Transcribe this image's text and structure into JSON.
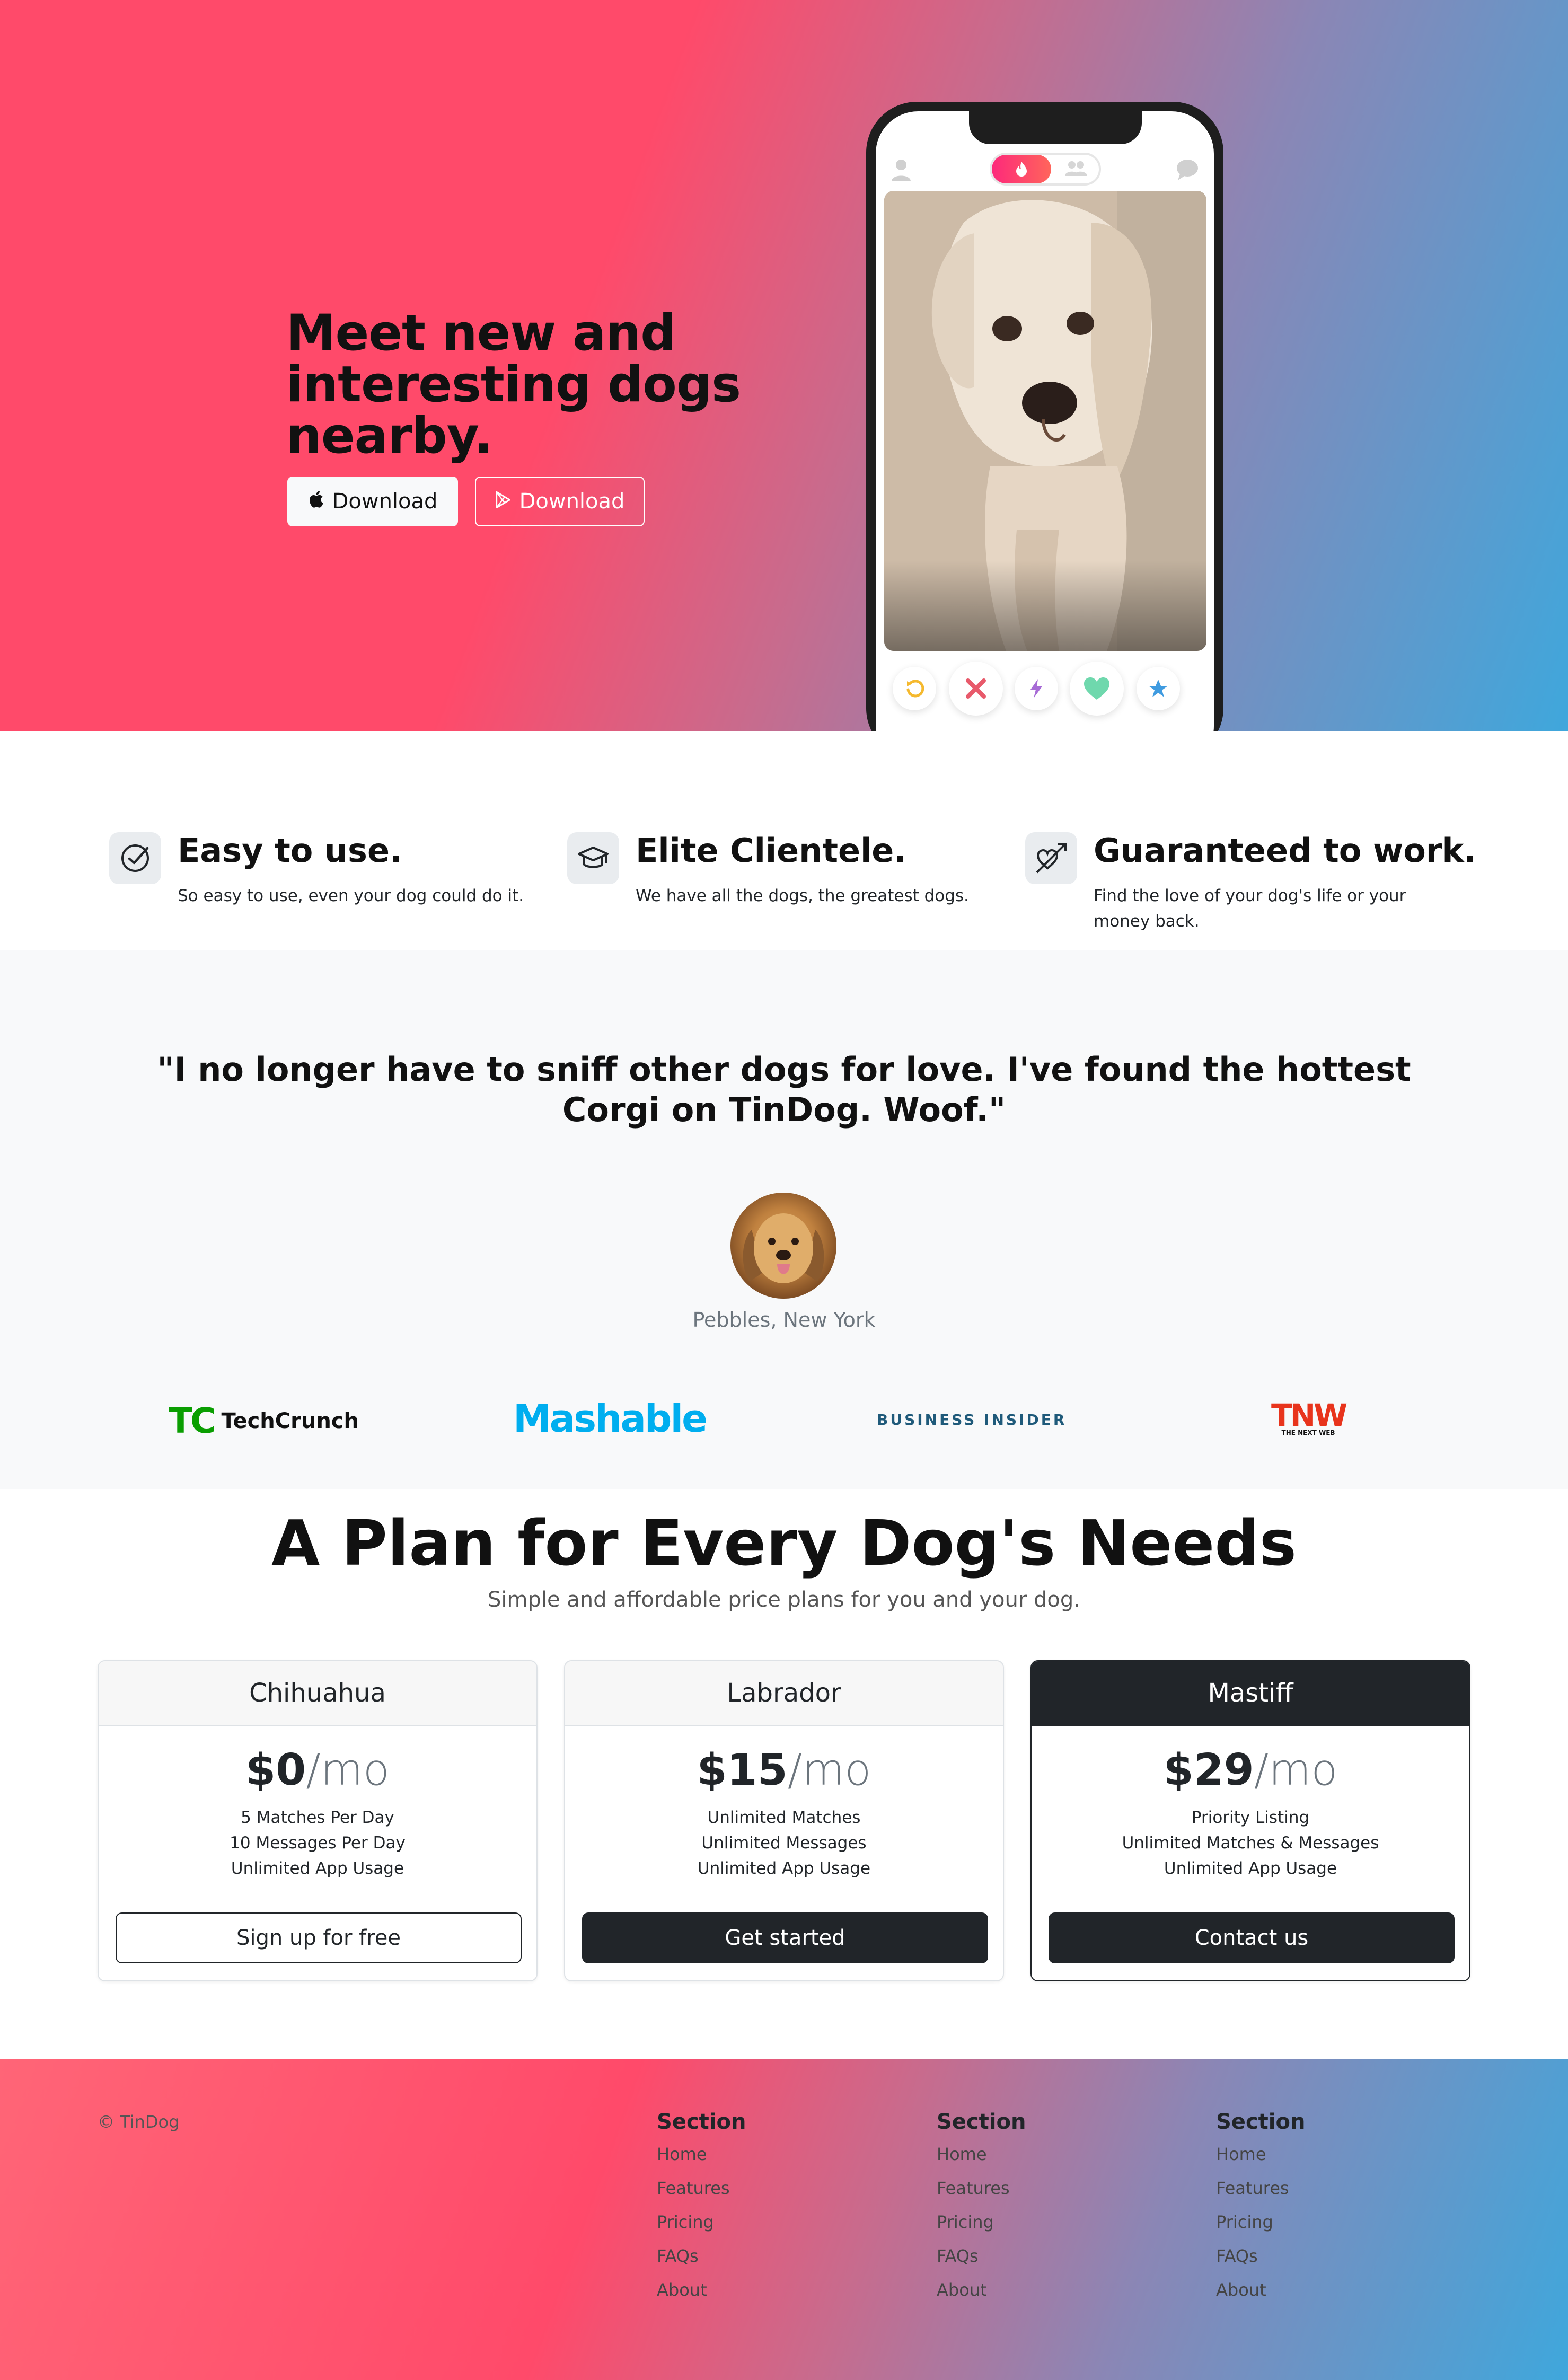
{
  "hero": {
    "title": "Meet new and interesting dogs nearby.",
    "apple_button_label": "Download",
    "play_button_label": "Download"
  },
  "features": [
    {
      "title": "Easy to use.",
      "text": "So easy to use, even your dog could do it.",
      "icon": "circle-check-icon"
    },
    {
      "title": "Elite Clientele.",
      "text": "We have all the dogs, the greatest dogs.",
      "icon": "mortarboard-icon"
    },
    {
      "title": "Guaranteed to work.",
      "text": "Find the love of your dog's life or your money back.",
      "icon": "heart-arrow-icon"
    }
  ],
  "testimonial": {
    "quote": "\"I no longer have to sniff other dogs for love. I've found the hottest Corgi on TinDog. Woof.\"",
    "author": "Pebbles, New York"
  },
  "press": [
    {
      "name": "TechCrunch",
      "mark": "TC",
      "color": "#0a9e01"
    },
    {
      "name": "Mashable",
      "color": "#00aeef"
    },
    {
      "name": "BUSINESS INSIDER",
      "color": "#1f5a7a"
    },
    {
      "name": "TNW",
      "sub": "THE NEXT WEB",
      "color": "#e8341c"
    }
  ],
  "pricing": {
    "title": "A Plan for Every Dog's Needs",
    "subtitle": "Simple and affordable price plans for you and your dog.",
    "plans": [
      {
        "name": "Chihuahua",
        "price": "$0",
        "period": "/mo",
        "features": [
          "5 Matches Per Day",
          "10 Messages Per Day",
          "Unlimited App Usage"
        ],
        "button": "Sign up for free"
      },
      {
        "name": "Labrador",
        "price": "$15",
        "period": "/mo",
        "features": [
          "Unlimited Matches",
          "Unlimited Messages",
          "Unlimited App Usage"
        ],
        "button": "Get started"
      },
      {
        "name": "Mastiff",
        "price": "$29",
        "period": "/mo",
        "features": [
          "Priority Listing",
          "Unlimited Matches & Messages",
          "Unlimited App Usage"
        ],
        "button": "Contact us"
      }
    ]
  },
  "footer": {
    "copyright": "© TinDog",
    "columns": [
      {
        "heading": "Section",
        "links": [
          "Home",
          "Features",
          "Pricing",
          "FAQs",
          "About"
        ]
      },
      {
        "heading": "Section",
        "links": [
          "Home",
          "Features",
          "Pricing",
          "FAQs",
          "About"
        ]
      },
      {
        "heading": "Section",
        "links": [
          "Home",
          "Features",
          "Pricing",
          "FAQs",
          "About"
        ]
      }
    ]
  },
  "colors": {
    "brand_pink": "#ff4a6a",
    "brand_blue": "#3fa7dc",
    "dark": "#212529"
  }
}
